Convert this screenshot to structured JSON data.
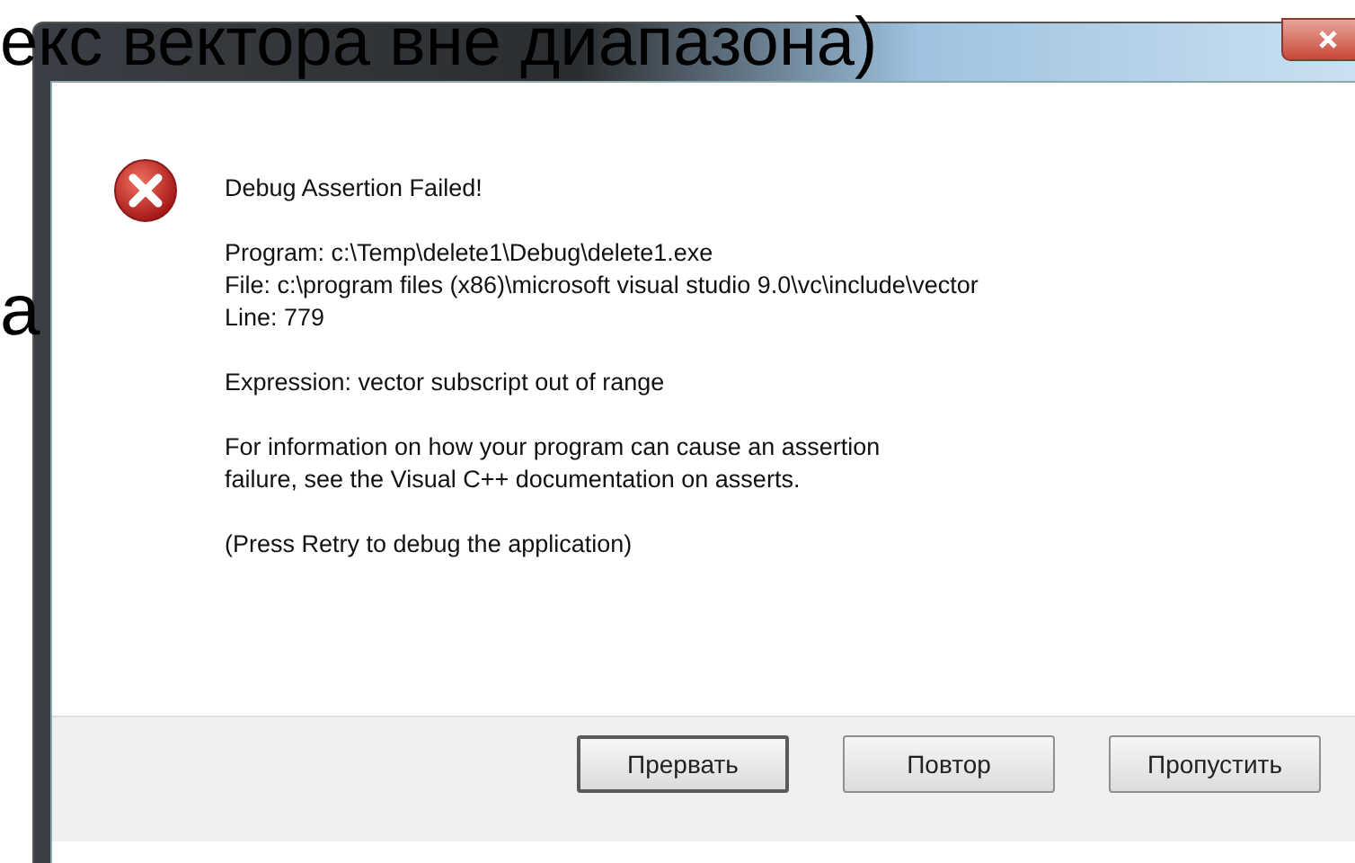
{
  "slide": {
    "heading": "екс вектора вне диапазона)",
    "side_text": "а"
  },
  "dialog": {
    "heading": "Debug Assertion Failed!",
    "paragraphs": [
      [
        "Program: c:\\Temp\\delete1\\Debug\\delete1.exe",
        "File: c:\\program files (x86)\\microsoft visual studio 9.0\\vc\\include\\vector",
        "Line: 779"
      ],
      [
        "Expression: vector subscript out of range"
      ],
      [
        "For information on how your program can cause an assertion",
        "failure, see the Visual C++ documentation on asserts."
      ],
      [
        "(Press Retry to debug the application)"
      ]
    ],
    "buttons": [
      {
        "label": "Прервать",
        "default": true
      },
      {
        "label": "Повтор",
        "default": false
      },
      {
        "label": "Пропустить",
        "default": false
      }
    ]
  }
}
